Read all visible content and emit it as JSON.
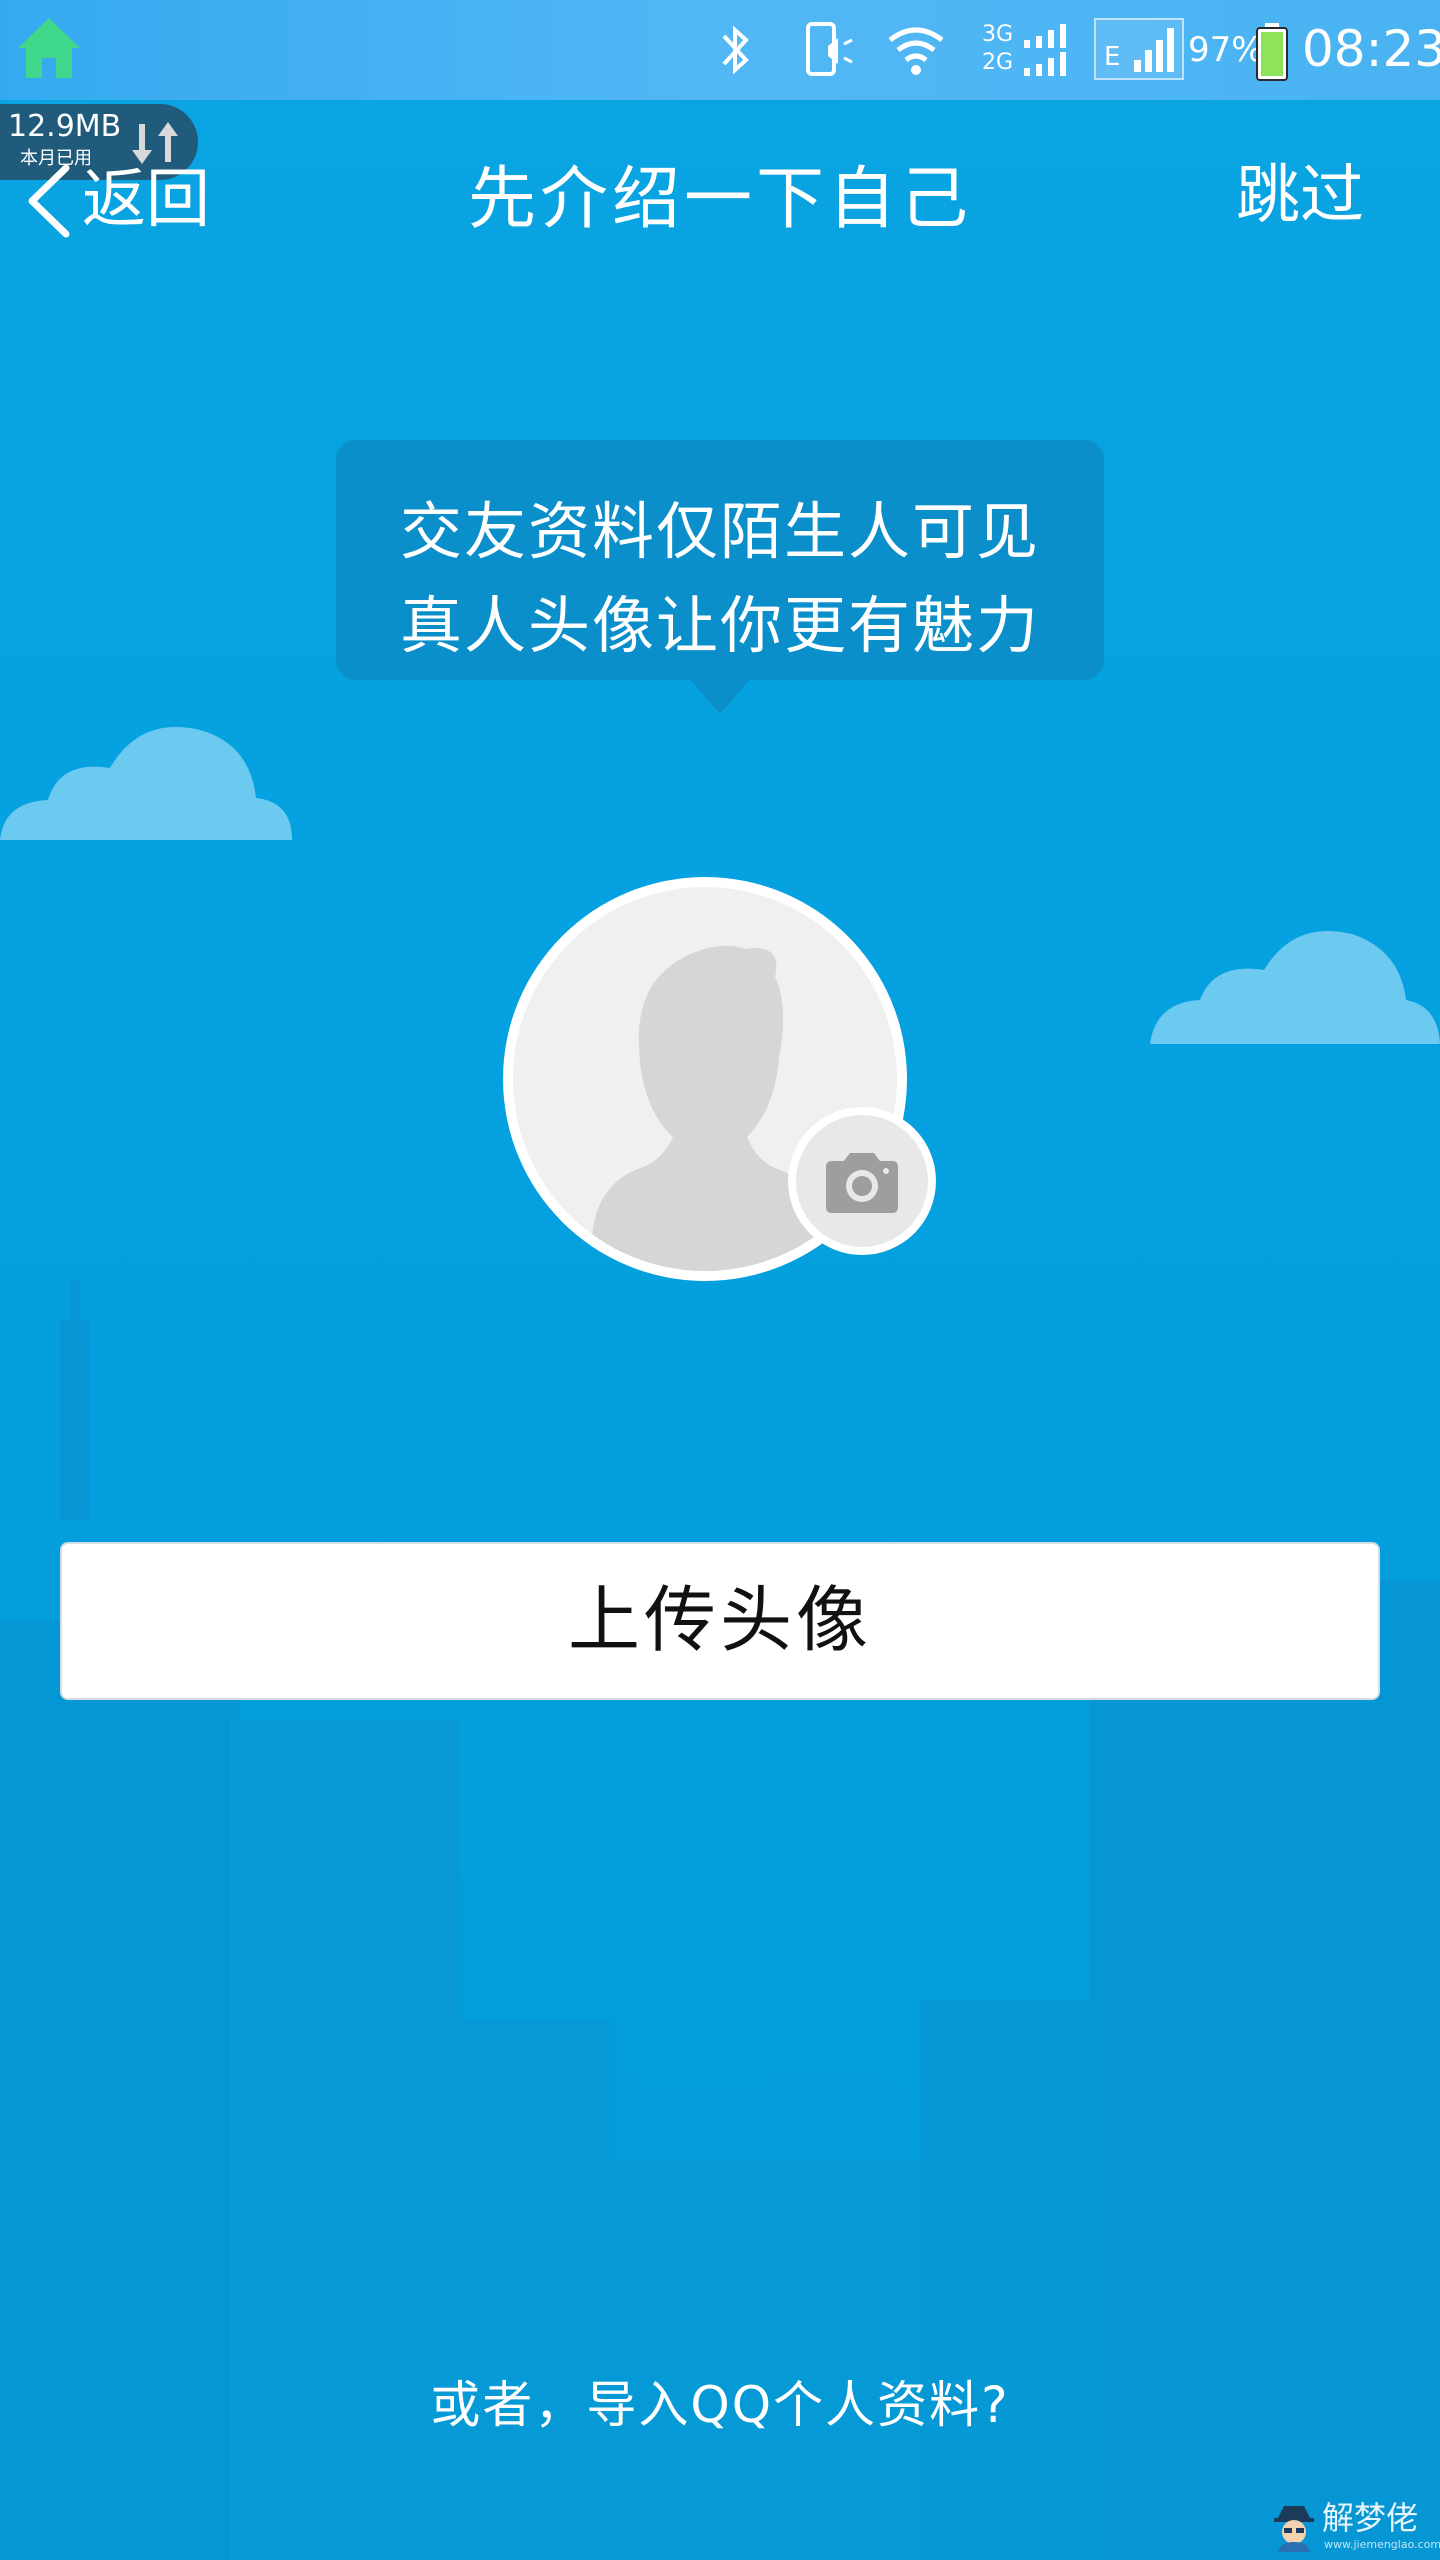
{
  "status_bar": {
    "battery_percent": "97%",
    "time": "08:23",
    "network_3g": "3G",
    "network_2g": "2G",
    "network_e": "E",
    "icons": [
      "home-icon",
      "bluetooth-icon",
      "vibrate-icon",
      "wifi-icon",
      "dual-sim-signal-icon",
      "mobile-signal-icon",
      "battery-icon"
    ]
  },
  "data_usage": {
    "amount": "12.9MB",
    "caption": "本月已用",
    "icon": "data-transfer-icon"
  },
  "header": {
    "back_label": "返回",
    "title": "先介绍一下自己",
    "skip_label": "跳过"
  },
  "bubble": {
    "line1": "交友资料仅陌生人可见",
    "line2": "真人头像让你更有魅力"
  },
  "avatar": {
    "placeholder_icon": "default-avatar-icon",
    "camera_icon": "camera-icon"
  },
  "upload_button": {
    "label": "上传头像"
  },
  "import_link": {
    "label": "或者，导入QQ个人资料?"
  },
  "watermark": {
    "text": "解梦佬",
    "url": "www.jiemenglao.com"
  },
  "colors": {
    "background": "#04a0df",
    "status_bar": "#49b3f2",
    "bubble": "#0b8fca",
    "cloud": "#6ccaf0",
    "home_icon": "#3fd88a"
  }
}
